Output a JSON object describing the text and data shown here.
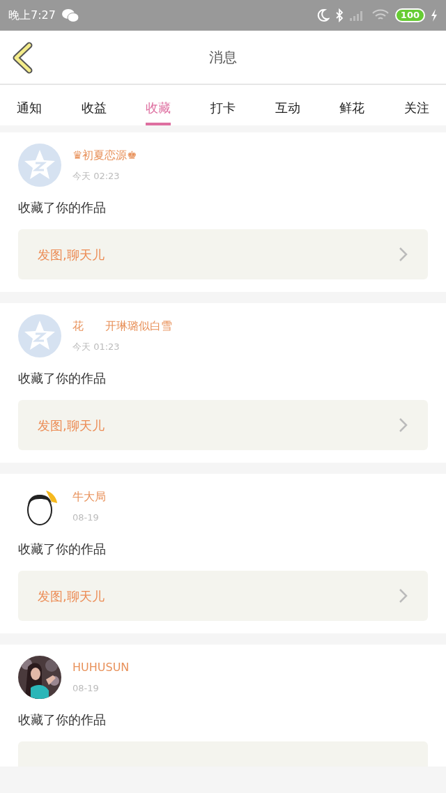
{
  "status_bar": {
    "time": "晚上7:27",
    "battery": "100"
  },
  "header": {
    "title": "消息"
  },
  "tabs": [
    {
      "label": "通知",
      "selected": false
    },
    {
      "label": "收益",
      "selected": false
    },
    {
      "label": "收藏",
      "selected": true
    },
    {
      "label": "打卡",
      "selected": false
    },
    {
      "label": "互动",
      "selected": false
    },
    {
      "label": "鲜花",
      "selected": false
    },
    {
      "label": "关注",
      "selected": false
    }
  ],
  "messages": [
    {
      "kind": "qq",
      "name": "♛初夏恋源♚",
      "time": "今天 02:23",
      "text": "收藏了你的作品",
      "link": "发图,聊天儿"
    },
    {
      "kind": "qq",
      "name": "花      开琳璐似白雪",
      "time": "今天 01:23",
      "text": "收藏了你的作品",
      "link": "发图,聊天儿"
    },
    {
      "kind": "cartoon",
      "name": "牛大局",
      "time": "08-19",
      "text": "收藏了你的作品",
      "link": "发图,聊天儿"
    },
    {
      "name": "HUHUSUN",
      "time": "08-19",
      "text": "收藏了你的作品"
    }
  ]
}
